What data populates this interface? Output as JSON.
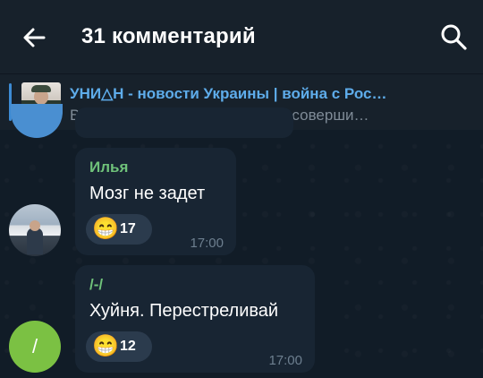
{
  "header": {
    "title": "31 комментарий",
    "back_icon": "arrow-left-icon",
    "search_icon": "search-icon"
  },
  "pinned": {
    "title": "УНИ△Н - новости Украины | война с Рос…",
    "text": "В Киеве сотрудник военкомата соверши…"
  },
  "messages": [
    {
      "author": "Илья",
      "text": "Мозг не задет",
      "reaction": {
        "emoji": "😁",
        "count": "17"
      },
      "time": "17:00"
    },
    {
      "author": "/-/",
      "avatar_letter": "/",
      "text": "Хуйня. Перестреливай",
      "reaction": {
        "emoji": "😁",
        "count": "12"
      },
      "time": "17:00"
    }
  ],
  "colors": {
    "header_bg": "#17212b",
    "bubble_bg": "#182533",
    "accent_blue": "#5eacea",
    "author_green": "#6fc27a",
    "avatar_green": "#7bc143"
  }
}
